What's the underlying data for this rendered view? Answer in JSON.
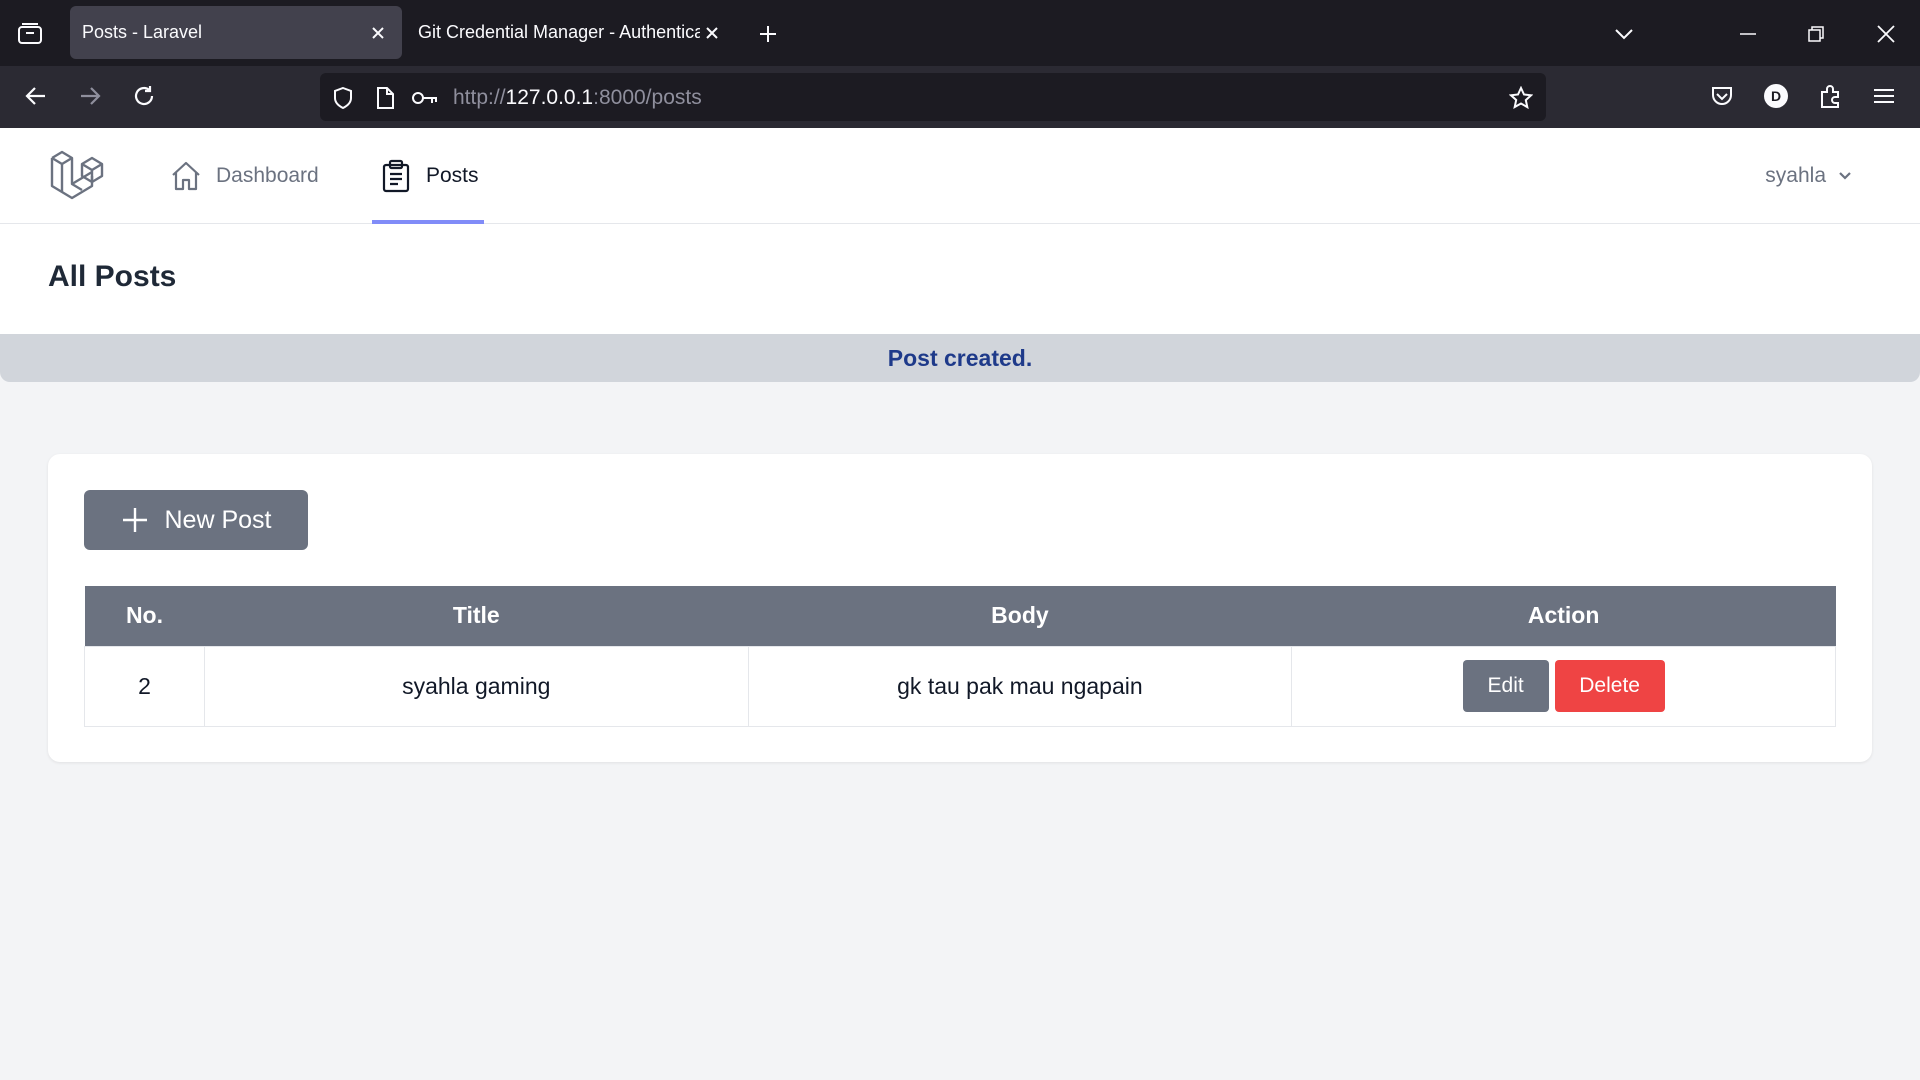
{
  "browser": {
    "tabs": [
      {
        "title": "Posts - Laravel",
        "active": true
      },
      {
        "title": "Git Credential Manager - Authentica",
        "active": false
      }
    ],
    "url": {
      "prefix": "http://",
      "host": "127.0.0.1",
      "rest": ":8000/posts"
    },
    "profile_initial": "D"
  },
  "app": {
    "nav": {
      "dashboard_label": "Dashboard",
      "posts_label": "Posts",
      "user_name": "syahla"
    },
    "page_title": "All Posts",
    "flash_message": "Post created.",
    "new_post_label": "New Post",
    "table": {
      "headers": [
        "No.",
        "Title",
        "Body",
        "Action"
      ],
      "rows": [
        {
          "no": "2",
          "title": "syahla gaming",
          "body": "gk tau pak mau ngapain"
        }
      ],
      "edit_label": "Edit",
      "delete_label": "Delete"
    }
  },
  "colors": {
    "accent_underline": "#818cf8",
    "flash_text": "#1e3a8a",
    "delete_button": "#ef4444",
    "neutral_button": "#6b7280"
  }
}
